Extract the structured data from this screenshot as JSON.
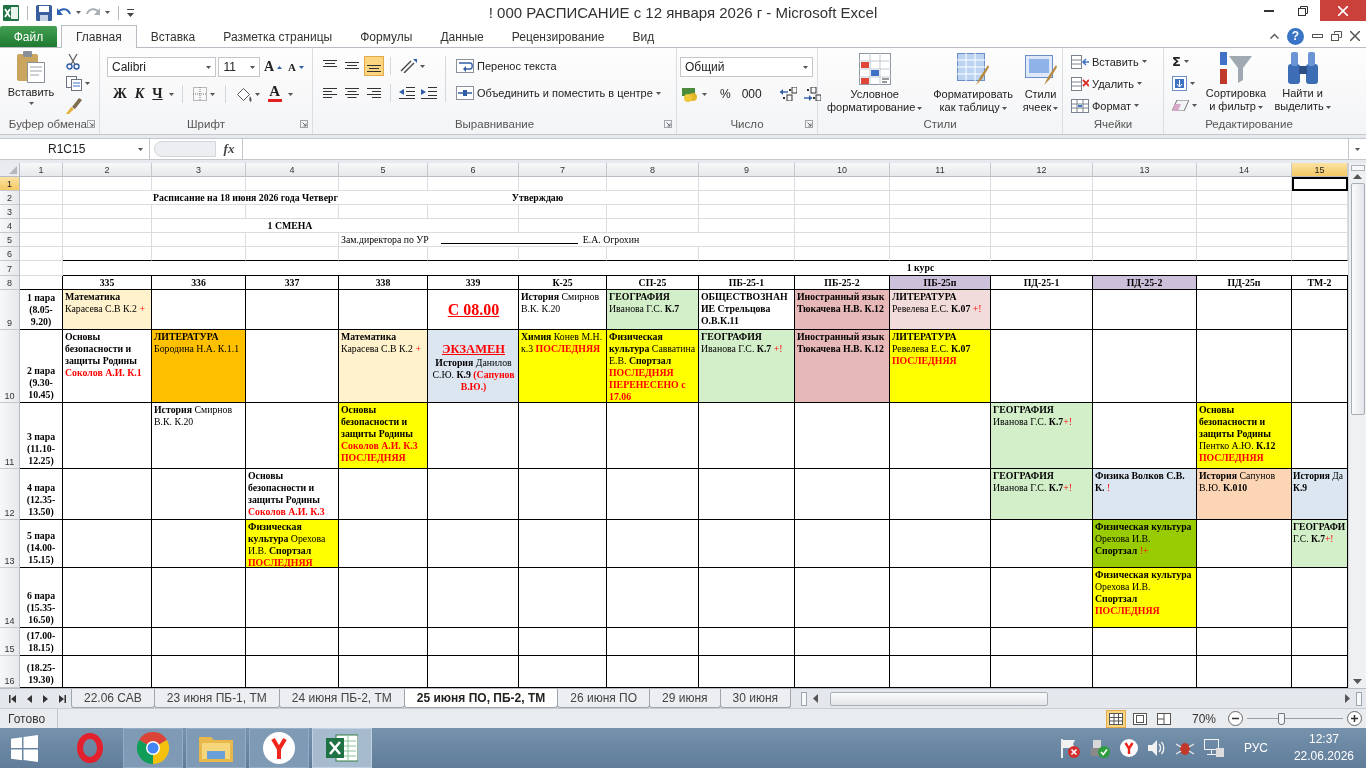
{
  "title_bar": {
    "title": "! 000 РАСПИСАНИЕ с 12 января 2026 г - Microsoft Excel"
  },
  "ribbon_tabs": [
    {
      "label": "Файл",
      "kind": "file",
      "selected": false
    },
    {
      "label": "Главная",
      "kind": "tab",
      "selected": true
    },
    {
      "label": "Вставка",
      "kind": "tab",
      "selected": false
    },
    {
      "label": "Разметка страницы",
      "kind": "tab",
      "selected": false
    },
    {
      "label": "Формулы",
      "kind": "tab",
      "selected": false
    },
    {
      "label": "Данные",
      "kind": "tab",
      "selected": false
    },
    {
      "label": "Рецензирование",
      "kind": "tab",
      "selected": false
    },
    {
      "label": "Вид",
      "kind": "tab",
      "selected": false
    }
  ],
  "help": "?",
  "ribbon": {
    "clipboard": {
      "label": "Буфер обмена",
      "paste": "Вставить"
    },
    "font": {
      "label": "Шрифт",
      "name": "Calibri",
      "size": "11",
      "grow_button": "A",
      "shrink_button": "A",
      "bold": "Ж",
      "italic": "К",
      "underline": "Ч",
      "font_color_button": "A"
    },
    "alignment": {
      "label": "Выравнивание",
      "vertical": [
        {
          "kind": "top",
          "selected": false
        },
        {
          "kind": "middle",
          "selected": false
        },
        {
          "kind": "bottom",
          "selected": true
        }
      ],
      "wrap_text": "Перенос текста",
      "merge": "Объединить и поместить в центре"
    },
    "number": {
      "label": "Число",
      "format": "Общий",
      "percent": "%",
      "thousands": "000"
    },
    "styles": {
      "label": "Стили",
      "buttons": [
        {
          "kind": "conditional",
          "label": "Условное форматирование"
        },
        {
          "kind": "table",
          "label": "Форматировать как таблицу"
        },
        {
          "kind": "cell_styles",
          "label": "Стили ячеек"
        }
      ]
    },
    "cells": {
      "label": "Ячейки",
      "buttons": [
        {
          "kind": "insert",
          "label": "Вставить"
        },
        {
          "kind": "delete",
          "label": "Удалить"
        },
        {
          "kind": "format",
          "label": "Формат"
        }
      ]
    },
    "editing": {
      "label": "Редактирование",
      "sum": "Σ",
      "buttons": [
        {
          "kind": "sort",
          "label": "Сортировка и фильтр"
        },
        {
          "kind": "find",
          "label": "Найти и выделить"
        }
      ]
    }
  },
  "formula_bar": {
    "name_box": "R1C15",
    "function_button": "fx"
  },
  "sheet": {
    "columns": [
      {
        "label": "1",
        "selected": false
      },
      {
        "label": "2",
        "selected": false
      },
      {
        "label": "3",
        "selected": false
      },
      {
        "label": "4",
        "selected": false
      },
      {
        "label": "5",
        "selected": false
      },
      {
        "label": "6",
        "selected": false
      },
      {
        "label": "7",
        "selected": false
      },
      {
        "label": "8",
        "selected": false
      },
      {
        "label": "9",
        "selected": false
      },
      {
        "label": "10",
        "selected": false
      },
      {
        "label": "11",
        "selected": false
      },
      {
        "label": "12",
        "selected": false
      },
      {
        "label": "13",
        "selected": false
      },
      {
        "label": "14",
        "selected": false
      },
      {
        "label": "15",
        "selected": true
      }
    ],
    "rows": [
      {
        "label": "1",
        "selected": true
      },
      {
        "label": "2",
        "selected": false
      },
      {
        "label": "3",
        "selected": false
      },
      {
        "label": "4",
        "selected": false
      },
      {
        "label": "5",
        "selected": false
      },
      {
        "label": "6",
        "selected": false
      },
      {
        "label": "7",
        "selected": false
      },
      {
        "label": "8",
        "selected": false
      },
      {
        "label": "9",
        "selected": false
      },
      {
        "label": "10",
        "selected": false
      },
      {
        "label": "11",
        "selected": false
      },
      {
        "label": "12",
        "selected": false
      },
      {
        "label": "13",
        "selected": false
      },
      {
        "label": "14",
        "selected": false
      },
      {
        "label": "15",
        "selected": false
      },
      {
        "label": "16",
        "selected": false
      }
    ],
    "title": "Расписание на 18 июня 2026 года Четверг",
    "approval": "Утверждаю",
    "shift": "1 СМЕНА",
    "deputy": "Зам.директора по УР",
    "signer": "Е.А. Огрохин",
    "course": "1 курс",
    "groups": [
      {
        "label": "335"
      },
      {
        "label": "336"
      },
      {
        "label": "337"
      },
      {
        "label": "338"
      },
      {
        "label": "339"
      },
      {
        "label": "К-25"
      },
      {
        "label": "СП-25"
      },
      {
        "label": "ПБ-25-1"
      },
      {
        "label": "ПБ-25-2"
      },
      {
        "label": "ПБ-25п",
        "color": "#ccc0da"
      },
      {
        "label": "ПД-25-1"
      },
      {
        "label": "ПД-25-2",
        "color": "#ccc0da"
      },
      {
        "label": "ПД-25п"
      },
      {
        "label": "ТМ-2"
      }
    ],
    "periods": [
      {
        "label": "1 пара",
        "time": "(8.05-9.20)",
        "cells": [
          {
            "kind": "lesson",
            "color": "#fff2cc",
            "lines": [
              [
                {
                  "kind": "bold",
                  "text": "Математика"
                },
                {
                  "kind": "plain",
                  "text": " Карасева С.В К.2 "
                },
                {
                  "kind": "mark",
                  "text": "+"
                }
              ]
            ]
          },
          null,
          null,
          null,
          {
            "kind": "notice",
            "lines": [
              [
                {
                  "kind": "headline",
                  "text": "С 08.00"
                }
              ]
            ]
          },
          {
            "kind": "lesson",
            "lines": [
              [
                {
                  "kind": "bold",
                  "text": "История"
                },
                {
                  "kind": "plain",
                  "text": " Смирнов В.К. К.20"
                }
              ]
            ]
          },
          {
            "kind": "lesson",
            "color": "#d3efc9",
            "lines": [
              [
                {
                  "kind": "bold",
                  "text": "ГЕОГРАФИЯ"
                },
                {
                  "kind": "plain",
                  "text": " Иванова Г.С. "
                },
                {
                  "kind": "bold",
                  "text": "К.7"
                }
              ]
            ]
          },
          {
            "kind": "lesson",
            "lines": [
              [
                {
                  "kind": "bold",
                  "text": "ОБЩЕСТВОЗНАНИЕ Стрельцова О.В.К.11"
                }
              ]
            ]
          },
          {
            "kind": "lesson",
            "color": "#e6b8b7",
            "lines": [
              [
                {
                  "kind": "bold",
                  "text": "Иностранный язык Тюкачева Н.В. К.12"
                }
              ]
            ]
          },
          {
            "kind": "lesson",
            "color": "#f2dcdb",
            "lines": [
              [
                {
                  "kind": "bold",
                  "text": "ЛИТЕРАТУРА"
                },
                {
                  "kind": "plain",
                  "text": " Ревелева Е.С. "
                },
                {
                  "kind": "bold",
                  "text": "К.07"
                },
                {
                  "kind": "mark",
                  "text": " +!"
                }
              ]
            ]
          },
          null,
          null,
          null,
          null
        ]
      },
      {
        "label": "2 пара",
        "time": "(9.30-10.45)",
        "cells": [
          {
            "kind": "lesson",
            "lines": [
              [
                {
                  "kind": "bold",
                  "text": "Основы безопасности и защиты Родины "
                },
                {
                  "kind": "alert",
                  "text": "Соколов А.И. К.1"
                }
              ]
            ]
          },
          {
            "kind": "lesson",
            "color": "#ffc000",
            "lines": [
              [
                {
                  "kind": "bold",
                  "text": "ЛИТЕРАТУРА"
                },
                {
                  "kind": "plain",
                  "text": " Бородина Н.А. К.1.1"
                }
              ]
            ]
          },
          null,
          {
            "kind": "lesson",
            "color": "#fff2cc",
            "lines": [
              [
                {
                  "kind": "bold",
                  "text": "Математика"
                },
                {
                  "kind": "plain",
                  "text": " Карасева С.В К.2 "
                },
                {
                  "kind": "mark",
                  "text": "+"
                }
              ]
            ]
          },
          {
            "kind": "notice",
            "color": "#dce6f1",
            "lines": [
              [
                {
                  "kind": "exam",
                  "text": "ЭКЗАМЕН"
                }
              ],
              [
                {
                  "kind": "bold",
                  "text": "История"
                },
                {
                  "kind": "plain",
                  "text": " Данилов С.Ю. "
                },
                {
                  "kind": "bold",
                  "text": "К.9"
                },
                {
                  "kind": "alert",
                  "text": " (Сапунов В.Ю.)"
                }
              ]
            ]
          },
          {
            "kind": "lesson",
            "color": "#ffff00",
            "lines": [
              [
                {
                  "kind": "bold",
                  "text": "Химия"
                },
                {
                  "kind": "plain",
                  "text": " Конев М.Н. к.3 "
                },
                {
                  "kind": "alert",
                  "text": "ПОСЛЕДНЯЯ"
                }
              ]
            ]
          },
          {
            "kind": "lesson",
            "color": "#ffff00",
            "lines": [
              [
                {
                  "kind": "bold",
                  "text": "Физическая культура"
                },
                {
                  "kind": "plain",
                  "text": " Савватина Е.В. "
                },
                {
                  "kind": "bold",
                  "text": "Спортзал"
                },
                {
                  "kind": "alert",
                  "text": " ПОСЛЕДНЯЯ ПЕРЕНЕСЕНО с 17.06"
                }
              ]
            ]
          },
          {
            "kind": "lesson",
            "color": "#d3efc9",
            "lines": [
              [
                {
                  "kind": "bold",
                  "text": "ГЕОГРАФИЯ"
                },
                {
                  "kind": "plain",
                  "text": " Иванова Г.С. "
                },
                {
                  "kind": "bold",
                  "text": "К.7"
                },
                {
                  "kind": "mark",
                  "text": " +!"
                }
              ]
            ]
          },
          {
            "kind": "lesson",
            "color": "#e6b8b7",
            "lines": [
              [
                {
                  "kind": "bold",
                  "text": "Иностранный язык Тюкачева Н.В. К.12"
                }
              ]
            ]
          },
          {
            "kind": "lesson",
            "color": "#ffff00",
            "lines": [
              [
                {
                  "kind": "bold",
                  "text": "ЛИТЕРАТУРА"
                },
                {
                  "kind": "plain",
                  "text": " Ревелева Е.С. "
                },
                {
                  "kind": "bold",
                  "text": "К.07"
                },
                {
                  "kind": "alert",
                  "text": " ПОСЛЕДНЯЯ"
                }
              ]
            ]
          },
          null,
          null,
          null,
          null
        ]
      },
      {
        "label": "3 пара",
        "time": "(11.10-12.25)",
        "cells": [
          null,
          {
            "kind": "lesson",
            "lines": [
              [
                {
                  "kind": "bold",
                  "text": "История"
                },
                {
                  "kind": "plain",
                  "text": " Смирнов В.К. К.20"
                }
              ]
            ]
          },
          null,
          {
            "kind": "lesson",
            "color": "#ffff00",
            "lines": [
              [
                {
                  "kind": "bold",
                  "text": "Основы безопасности и защиты Родины "
                },
                {
                  "kind": "alert",
                  "text": "Соколов А.И. К.3 ПОСЛЕДНЯЯ"
                }
              ]
            ]
          },
          null,
          null,
          null,
          null,
          null,
          null,
          {
            "kind": "lesson",
            "color": "#d3efc9",
            "lines": [
              [
                {
                  "kind": "bold",
                  "text": "ГЕОГРАФИЯ"
                },
                {
                  "kind": "plain",
                  "text": " Иванова Г.С. "
                },
                {
                  "kind": "bold",
                  "text": "К.7"
                },
                {
                  "kind": "mark",
                  "text": "+!"
                }
              ]
            ]
          },
          null,
          {
            "kind": "lesson",
            "color": "#ffff00",
            "lines": [
              [
                {
                  "kind": "bold",
                  "text": "Основы безопасности и защиты Родины "
                },
                {
                  "kind": "plain",
                  "text": "Пентко А.Ю. "
                },
                {
                  "kind": "bold",
                  "text": "К.12 "
                },
                {
                  "kind": "alert",
                  "text": "ПОСЛЕДНЯЯ"
                }
              ]
            ]
          },
          null
        ]
      },
      {
        "label": "4 пара",
        "time": "(12.35-13.50)",
        "cells": [
          null,
          null,
          {
            "kind": "lesson",
            "lines": [
              [
                {
                  "kind": "bold",
                  "text": "Основы безопасности и защиты Родины "
                },
                {
                  "kind": "alert",
                  "text": "Соколов А.И. К.3"
                }
              ]
            ]
          },
          null,
          null,
          null,
          null,
          null,
          null,
          null,
          {
            "kind": "lesson",
            "color": "#d3efc9",
            "lines": [
              [
                {
                  "kind": "bold",
                  "text": "ГЕОГРАФИЯ"
                },
                {
                  "kind": "plain",
                  "text": " Иванова Г.С. "
                },
                {
                  "kind": "bold",
                  "text": "К.7"
                },
                {
                  "kind": "mark",
                  "text": "+!"
                }
              ]
            ]
          },
          {
            "kind": "lesson",
            "color": "#dce6f1",
            "lines": [
              [
                {
                  "kind": "bold",
                  "text": "Физика Волков С.В. К."
                },
                {
                  "kind": "mark",
                  "text": " !"
                }
              ]
            ]
          },
          {
            "kind": "lesson",
            "color": "#fcd5b4",
            "lines": [
              [
                {
                  "kind": "bold",
                  "text": "История"
                },
                {
                  "kind": "plain",
                  "text": " Сапунов В.Ю. "
                },
                {
                  "kind": "bold",
                  "text": "К.010"
                }
              ]
            ]
          },
          {
            "kind": "lesson",
            "color": "#dce6f1",
            "lines": [
              [
                {
                  "kind": "bold",
                  "text": "История"
                },
                {
                  "kind": "plain",
                  "text": " Да"
                }
              ],
              [
                {
                  "kind": "bold",
                  "text": "К.9"
                }
              ]
            ]
          }
        ]
      },
      {
        "label": "5 пара",
        "time": "(14.00-15.15)",
        "cells": [
          null,
          null,
          {
            "kind": "lesson",
            "color": "#ffff00",
            "lines": [
              [
                {
                  "kind": "bold",
                  "text": "Физическая культура"
                },
                {
                  "kind": "plain",
                  "text": " Орехова И.В. "
                },
                {
                  "kind": "bold",
                  "text": "Спортзал"
                },
                {
                  "kind": "alert",
                  "text": " ПОСЛЕДНЯЯ"
                }
              ]
            ]
          },
          null,
          null,
          null,
          null,
          null,
          null,
          null,
          null,
          {
            "kind": "lesson",
            "color": "#99cc00",
            "lines": [
              [
                {
                  "kind": "bold",
                  "text": "Физическая культура"
                },
                {
                  "kind": "plain",
                  "text": " Орехова И.В. "
                },
                {
                  "kind": "bold",
                  "text": "Спортзал"
                },
                {
                  "kind": "mark",
                  "text": " !+"
                }
              ]
            ]
          },
          null,
          {
            "kind": "lesson",
            "color": "#d3efc9",
            "lines": [
              [
                {
                  "kind": "bold",
                  "text": "ГЕОГРАФИ"
                }
              ],
              [
                {
                  "kind": "plain",
                  "text": "Г.С. "
                },
                {
                  "kind": "bold",
                  "text": "К.7"
                },
                {
                  "kind": "mark",
                  "text": "+!"
                }
              ]
            ]
          }
        ]
      },
      {
        "label": "6 пара",
        "time": "(15.35-16.50)",
        "cells": [
          null,
          null,
          null,
          null,
          null,
          null,
          null,
          null,
          null,
          null,
          null,
          {
            "kind": "lesson",
            "color": "#ffff00",
            "lines": [
              [
                {
                  "kind": "bold",
                  "text": "Физическая культура"
                },
                {
                  "kind": "plain",
                  "text": " Орехова И.В. "
                },
                {
                  "kind": "bold",
                  "text": "Спортзал"
                },
                {
                  "kind": "alert",
                  "text": " ПОСЛЕДНЯЯ"
                }
              ]
            ]
          },
          null,
          null
        ]
      },
      {
        "time": "(17.00-18.15)",
        "cells": [
          null,
          null,
          null,
          null,
          null,
          null,
          null,
          null,
          null,
          null,
          null,
          null,
          null,
          null
        ]
      },
      {
        "time": "(18.25-19.30)",
        "cells": [
          null,
          null,
          null,
          null,
          null,
          null,
          null,
          null,
          null,
          null,
          null,
          null,
          null,
          null
        ]
      }
    ]
  },
  "sheet_tabs": [
    {
      "label": "22.06 САВ",
      "selected": false
    },
    {
      "label": "23 июня ПБ-1, ТМ",
      "selected": false
    },
    {
      "label": "24 июня ПБ-2, ТМ",
      "selected": false
    },
    {
      "label": "25 июня ПО, ПБ-2, ТМ",
      "selected": true
    },
    {
      "label": "26 июня ПО",
      "selected": false
    },
    {
      "label": "29 июня",
      "selected": false
    },
    {
      "label": "30 июня",
      "selected": false
    }
  ],
  "status_bar": {
    "text": "Готово",
    "views": [
      {
        "kind": "normal",
        "selected": true
      },
      {
        "kind": "page_layout",
        "selected": false
      },
      {
        "kind": "page_break",
        "selected": false
      }
    ],
    "zoom": "70%",
    "zoom_slider": {
      "level": 0.35
    }
  },
  "taskbar": {
    "apps": [
      {
        "kind": "ring",
        "running": false,
        "selected": false
      },
      {
        "kind": "ball",
        "running": true,
        "selected": false
      },
      {
        "kind": "folder",
        "running": true,
        "selected": false
      },
      {
        "kind": "y-mark",
        "running": true,
        "selected": false
      },
      {
        "kind": "spreadsheet",
        "running": true,
        "selected": true
      }
    ],
    "language": "РУС",
    "time": "12:37",
    "date": "22.06.2026"
  }
}
